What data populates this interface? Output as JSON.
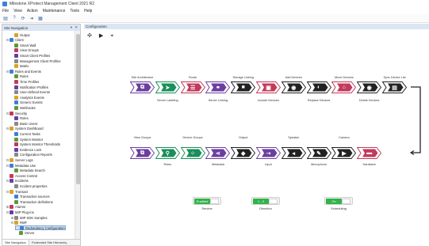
{
  "window": {
    "title": "Milestone XProtect Management Client 2021 R2"
  },
  "menu": [
    "File",
    "View",
    "Action",
    "Maintenance",
    "Tools",
    "Help"
  ],
  "nav": {
    "header": "Site Navigation",
    "header_controls": "▾ ✕",
    "tree": [
      {
        "label": "Output",
        "level": 2
      },
      {
        "label": "Client",
        "level": 1,
        "exp": "⊟"
      },
      {
        "label": "Smart Wall",
        "level": 2
      },
      {
        "label": "View Groups",
        "level": 2
      },
      {
        "label": "Smart Client Profiles",
        "level": 2
      },
      {
        "label": "Management Client Profiles",
        "level": 2
      },
      {
        "label": "Matrix",
        "level": 2
      },
      {
        "label": "Rules and Events",
        "level": 1,
        "exp": "⊟"
      },
      {
        "label": "Rules",
        "level": 2
      },
      {
        "label": "Time Profiles",
        "level": 2
      },
      {
        "label": "Notification Profiles",
        "level": 2
      },
      {
        "label": "User-defined Events",
        "level": 2
      },
      {
        "label": "Analytics Events",
        "level": 2
      },
      {
        "label": "Generic Events",
        "level": 2
      },
      {
        "label": "Webhooks",
        "level": 2
      },
      {
        "label": "Security",
        "level": 1,
        "exp": "⊟"
      },
      {
        "label": "Roles",
        "level": 2
      },
      {
        "label": "Basic Users",
        "level": 2
      },
      {
        "label": "System Dashboard",
        "level": 1,
        "exp": "⊟"
      },
      {
        "label": "Current Tasks",
        "level": 2
      },
      {
        "label": "System Monitor",
        "level": 2
      },
      {
        "label": "System Monitor Thresholds",
        "level": 2
      },
      {
        "label": "Evidence Lock",
        "level": 2
      },
      {
        "label": "Configuration Reports",
        "level": 2
      },
      {
        "label": "Server Logs",
        "level": 1,
        "exp": "⊟"
      },
      {
        "label": "Metadata Use",
        "level": 1,
        "exp": "⊟"
      },
      {
        "label": "Metadata Search",
        "level": 2
      },
      {
        "label": "Access Control",
        "level": 1,
        "exp": ""
      },
      {
        "label": "Incidents",
        "level": 1,
        "exp": "⊟"
      },
      {
        "label": "Incident properties",
        "level": 2
      },
      {
        "label": "Transact",
        "level": 1,
        "exp": "⊟"
      },
      {
        "label": "Transaction sources",
        "level": 2
      },
      {
        "label": "Transaction definitions",
        "level": 2
      },
      {
        "label": "Alarms",
        "level": 1,
        "exp": "⊞"
      },
      {
        "label": "MIP Plug-ins",
        "level": 1,
        "exp": "⊟"
      },
      {
        "label": "MIP SDK Samples",
        "level": 2,
        "exp": "⊞"
      },
      {
        "label": "RMF",
        "level": 2,
        "exp": "⊟"
      },
      {
        "label": "Redundancy Configuration",
        "level": 3,
        "selected": true
      },
      {
        "label": "Server",
        "level": 3
      }
    ],
    "bottom_tabs": [
      "Site Navigation",
      "Federated Site Hierarchy"
    ]
  },
  "main": {
    "header": "Configuration",
    "tools": [
      "✣",
      "▶",
      "⌖"
    ],
    "row1_top": [
      {
        "text": "Site Architecture",
        "col": 0
      },
      {
        "text": "Route",
        "col": 2
      },
      {
        "text": "Storage Linking",
        "col": 4
      },
      {
        "text": "Add Devices",
        "col": 6
      },
      {
        "text": "Move Devices",
        "col": 8
      },
      {
        "text": "Sync Device List",
        "col": 10
      }
    ],
    "row1_bottom": [
      {
        "text": "Server Labeling",
        "col": 1
      },
      {
        "text": "Server Linking",
        "col": 3
      },
      {
        "text": "Include Devices",
        "col": 5
      },
      {
        "text": "Replace Devices",
        "col": 7
      },
      {
        "text": "Delete Devices",
        "col": 9
      }
    ],
    "row2_top": [
      {
        "text": "View Groups",
        "col": 0
      },
      {
        "text": "Device Groups",
        "col": 2
      },
      {
        "text": "Output",
        "col": 4
      },
      {
        "text": "Speaker",
        "col": 6
      },
      {
        "text": "Camera",
        "col": 8
      }
    ],
    "row2_bottom": [
      {
        "text": "Roles",
        "col": 1
      },
      {
        "text": "Metadata",
        "col": 3
      },
      {
        "text": "Input",
        "col": 5
      },
      {
        "text": "Microphone",
        "col": 7
      },
      {
        "text": "Hardware",
        "col": 9
      }
    ],
    "row1_nodes": [
      {
        "icon": "sitemap-icon",
        "glyph": "⧉",
        "color": "#6b3fa0"
      },
      {
        "icon": "tag-icon",
        "glyph": "➤",
        "color": "#1a8f5a"
      },
      {
        "icon": "route-icon",
        "glyph": "☰",
        "color": "#c23a5b"
      },
      {
        "icon": "link-icon",
        "glyph": "⚭",
        "color": "#6b3fa0"
      },
      {
        "icon": "storage-icon",
        "glyph": "■",
        "color": "#222222"
      },
      {
        "icon": "include-icon",
        "glyph": "▣",
        "color": "#c23a5b"
      },
      {
        "icon": "add-device-icon",
        "glyph": "◉",
        "color": "#222222"
      },
      {
        "icon": "replace-icon",
        "glyph": "◐",
        "color": "#222222"
      },
      {
        "icon": "move-device-icon",
        "glyph": "⌂",
        "color": "#c23a5b"
      },
      {
        "icon": "delete-device-icon",
        "glyph": "◉",
        "color": "#222222"
      },
      {
        "icon": "sync-list-icon",
        "glyph": "▤",
        "color": "#222222"
      }
    ],
    "row2_nodes": [
      {
        "icon": "view-groups-icon",
        "glyph": "⧉",
        "color": "#6b3fa0"
      },
      {
        "icon": "roles-icon",
        "glyph": "⚲",
        "color": "#1a8f5a"
      },
      {
        "icon": "device-groups-icon",
        "glyph": "⁘",
        "color": "#1a8f5a"
      },
      {
        "icon": "metadata-icon",
        "glyph": "⋖",
        "color": "#6b3fa0"
      },
      {
        "icon": "output-icon",
        "glyph": "◆",
        "color": "#222222"
      },
      {
        "icon": "input-icon",
        "glyph": "⇢",
        "color": "#6b3fa0"
      },
      {
        "icon": "speaker-icon",
        "glyph": "◂",
        "color": "#222222"
      },
      {
        "icon": "microphone-icon",
        "glyph": "✎",
        "color": "#222222"
      },
      {
        "icon": "camera-icon",
        "glyph": "▶",
        "color": "#222222"
      },
      {
        "icon": "hardware-icon",
        "glyph": "▬",
        "color": "#c23a5b"
      }
    ],
    "toggles": [
      {
        "state": "Enabled",
        "label": "Service"
      },
      {
        "state": "1 - 0",
        "label": "Direction"
      },
      {
        "state": "On",
        "label": "Scheduling"
      }
    ]
  }
}
